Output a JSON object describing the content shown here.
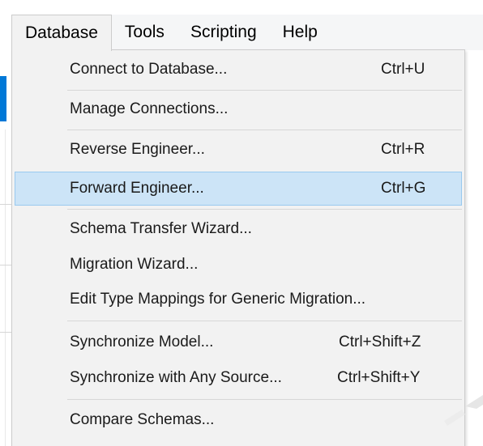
{
  "menubar": {
    "items": [
      {
        "label": "Database",
        "active": true
      },
      {
        "label": "Tools",
        "active": false
      },
      {
        "label": "Scripting",
        "active": false
      },
      {
        "label": "Help",
        "active": false
      }
    ]
  },
  "database_menu": {
    "items": [
      {
        "label": "Connect to Database...",
        "shortcut": "Ctrl+U"
      },
      {
        "label": "Manage Connections...",
        "shortcut": ""
      },
      {
        "label": "Reverse Engineer...",
        "shortcut": "Ctrl+R"
      },
      {
        "label": "Forward Engineer...",
        "shortcut": "Ctrl+G",
        "highlighted": true
      },
      {
        "label": "Schema Transfer Wizard...",
        "shortcut": ""
      },
      {
        "label": "Migration Wizard...",
        "shortcut": ""
      },
      {
        "label": "Edit Type Mappings for Generic Migration...",
        "shortcut": ""
      },
      {
        "label": "Synchronize Model...",
        "shortcut": "Ctrl+Shift+Z"
      },
      {
        "label": "Synchronize with Any Source...",
        "shortcut": "Ctrl+Shift+Y"
      },
      {
        "label": "Compare Schemas...",
        "shortcut": ""
      }
    ]
  },
  "colors": {
    "highlight_bg": "#cce4f7",
    "highlight_border": "#99c9ef",
    "menu_bg": "#f2f2f2",
    "accent": "#0078d7"
  }
}
